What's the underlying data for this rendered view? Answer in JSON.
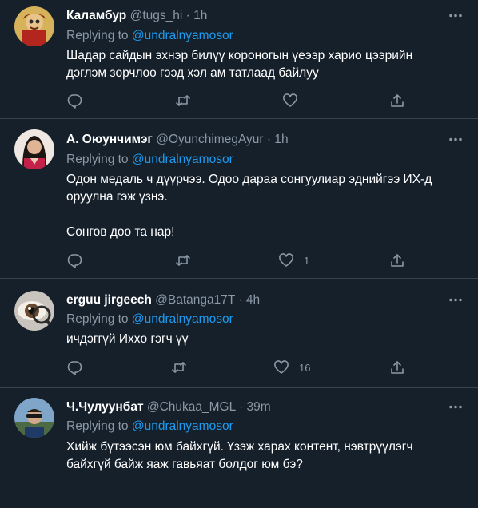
{
  "replying_to_label": "Replying to",
  "dot": "·",
  "colors": {
    "background": "#15202b",
    "mention": "#1d9bf0",
    "muted": "#8b98a5",
    "divider": "#38444d"
  },
  "tweets": [
    {
      "name": "Каламбур",
      "handle": "@tugs_hi",
      "time": "1h",
      "mention": "@undralnyamosor",
      "text": "Шадар сайдын эхнэр билүү короногын үеээр харио цээрийн\nдэглэм зөрчлөө гээд хэл ам татлаад байлуу",
      "likes": ""
    },
    {
      "name": "А. Оюунчимэг",
      "handle": "@OyunchimegAyur",
      "time": "1h",
      "mention": "@undralnyamosor",
      "text": "Одон медаль ч дүүрчээ. Одоо дараа сонгуулиар эднийгээ ИХ-д\nоруулна гэж үзнэ.\n\nСонгов доо та нар!",
      "likes": "1"
    },
    {
      "name": "erguu jirgeech",
      "handle": "@Batanga17T",
      "time": "4h",
      "mention": "@undralnyamosor",
      "text": "ичдэггүй Ихxо гэгч үү",
      "likes": "16"
    },
    {
      "name": "Ч.Чулуунбат",
      "handle": "@Chukaa_MGL",
      "time": "39m",
      "mention": "@undralnyamosor",
      "text": "Хийж бүтээсэн юм байхгүй. Үзэж харах контент, нэвтрүүлэгч\nбайхгүй байж яаж гавьяат болдог юм бэ?",
      "likes": ""
    }
  ],
  "icons": {
    "reply": "reply-icon",
    "retweet": "retweet-icon",
    "like": "heart-icon",
    "share": "share-icon",
    "more": "more-icon"
  }
}
